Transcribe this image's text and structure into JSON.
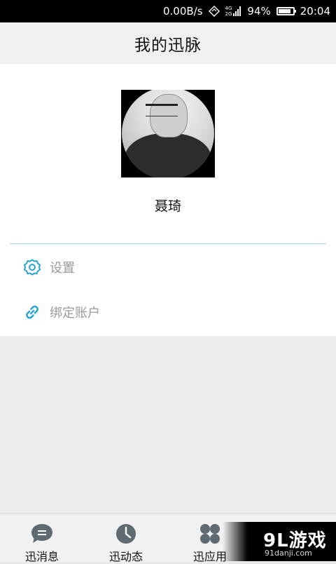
{
  "status_bar": {
    "speed": "0.00B/s",
    "network_top": "4G",
    "network_bottom": "2G",
    "battery": "94%",
    "battery_level": 0.94,
    "time": "20:04"
  },
  "header": {
    "title": "我的迅脉"
  },
  "profile": {
    "name": "聂琦"
  },
  "menu": [
    {
      "icon": "gear-icon",
      "label": "设置"
    },
    {
      "icon": "link-icon",
      "label": "绑定账户"
    }
  ],
  "bottom_nav": [
    {
      "icon": "chat-bubble-icon",
      "label": "迅消息"
    },
    {
      "icon": "clock-icon",
      "label": "迅动态"
    },
    {
      "icon": "clover-icon",
      "label": "迅应用"
    }
  ],
  "watermark": {
    "logo": "9L游戏",
    "url": "91danji.com"
  },
  "colors": {
    "accent": "#29a3d6",
    "nav_icon": "#5f6b73",
    "title_bar_bg": "#f0f0f0",
    "page_bg": "#ebebeb"
  }
}
